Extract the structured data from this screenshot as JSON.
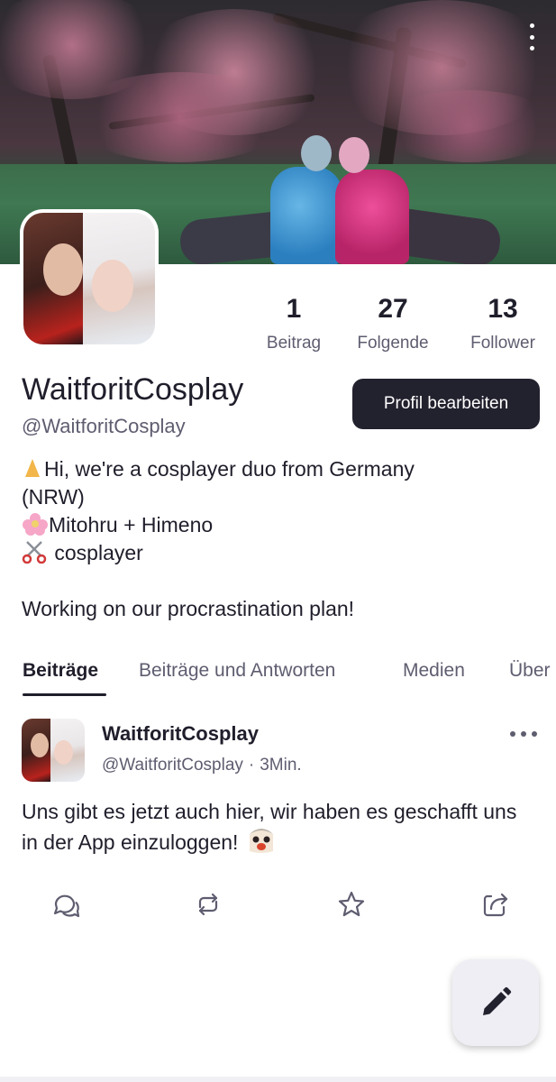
{
  "profile": {
    "display_name": "WaitforitCosplay",
    "handle": "@WaitforitCosplay",
    "edit_button": "Profil bearbeiten",
    "stats": [
      {
        "value": "1",
        "label": "Beitrag"
      },
      {
        "value": "27",
        "label": "Folgende"
      },
      {
        "value": "13",
        "label": "Follower"
      }
    ],
    "bio": {
      "line1": "Hi, we're a cosplayer duo from Germany",
      "line2": "(NRW)",
      "line3": "Mitohru + Himeno",
      "line4": " cosplayer",
      "line5": "Working on our procrastination plan!"
    }
  },
  "tabs": [
    "Beiträge",
    "Beiträge und Antworten",
    "Medien",
    "Über"
  ],
  "post": {
    "author": "WaitforitCosplay",
    "handle": "@WaitforitCosplay",
    "separator": "·",
    "time": "3Min.",
    "text": "Uns gibt es jetzt auch hier, wir haben es geschafft uns in der App einzuloggen!"
  },
  "icons": {
    "menu": "more-vertical-icon",
    "post_more": "more-horizontal-icon",
    "reply": "reply-icon",
    "repost": "repost-icon",
    "like": "star-icon",
    "share": "share-icon",
    "compose": "pencil-icon"
  },
  "colors": {
    "primary_text": "#1f1e2b",
    "secondary_text": "#5e5d70",
    "button_bg": "#22212e",
    "fab_bg": "#efeef4"
  }
}
